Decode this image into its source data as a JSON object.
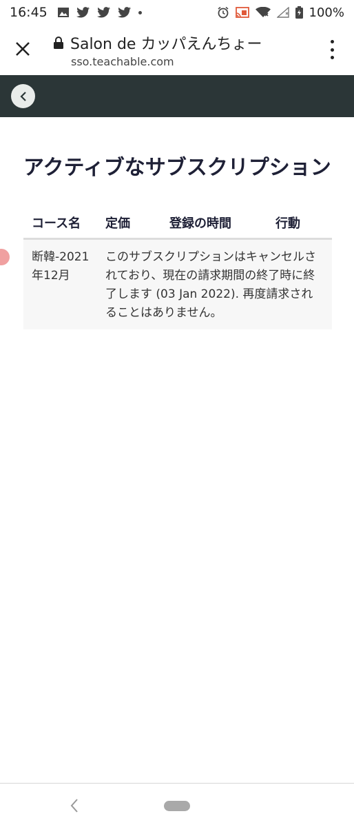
{
  "status_bar": {
    "time": "16:45",
    "battery": "100%"
  },
  "browser": {
    "page_title": "Salon de カッパえんちょー",
    "url": "sso.teachable.com"
  },
  "page": {
    "heading": "アクティブなサブスクリプション",
    "table": {
      "headers": [
        "コース名",
        "定価",
        "登録の時間",
        "行動"
      ],
      "rows": [
        {
          "course": "断韓-2021年12月",
          "status": "このサブスクリプションはキャンセルされており、現在の請求期間の終了時に終了します (03 Jan 2022). 再度請求されることはありません。"
        }
      ]
    }
  },
  "colors": {
    "header_bg": "#2b3637",
    "heading_text": "#1e2036",
    "row_bg": "#f7f7f7"
  }
}
